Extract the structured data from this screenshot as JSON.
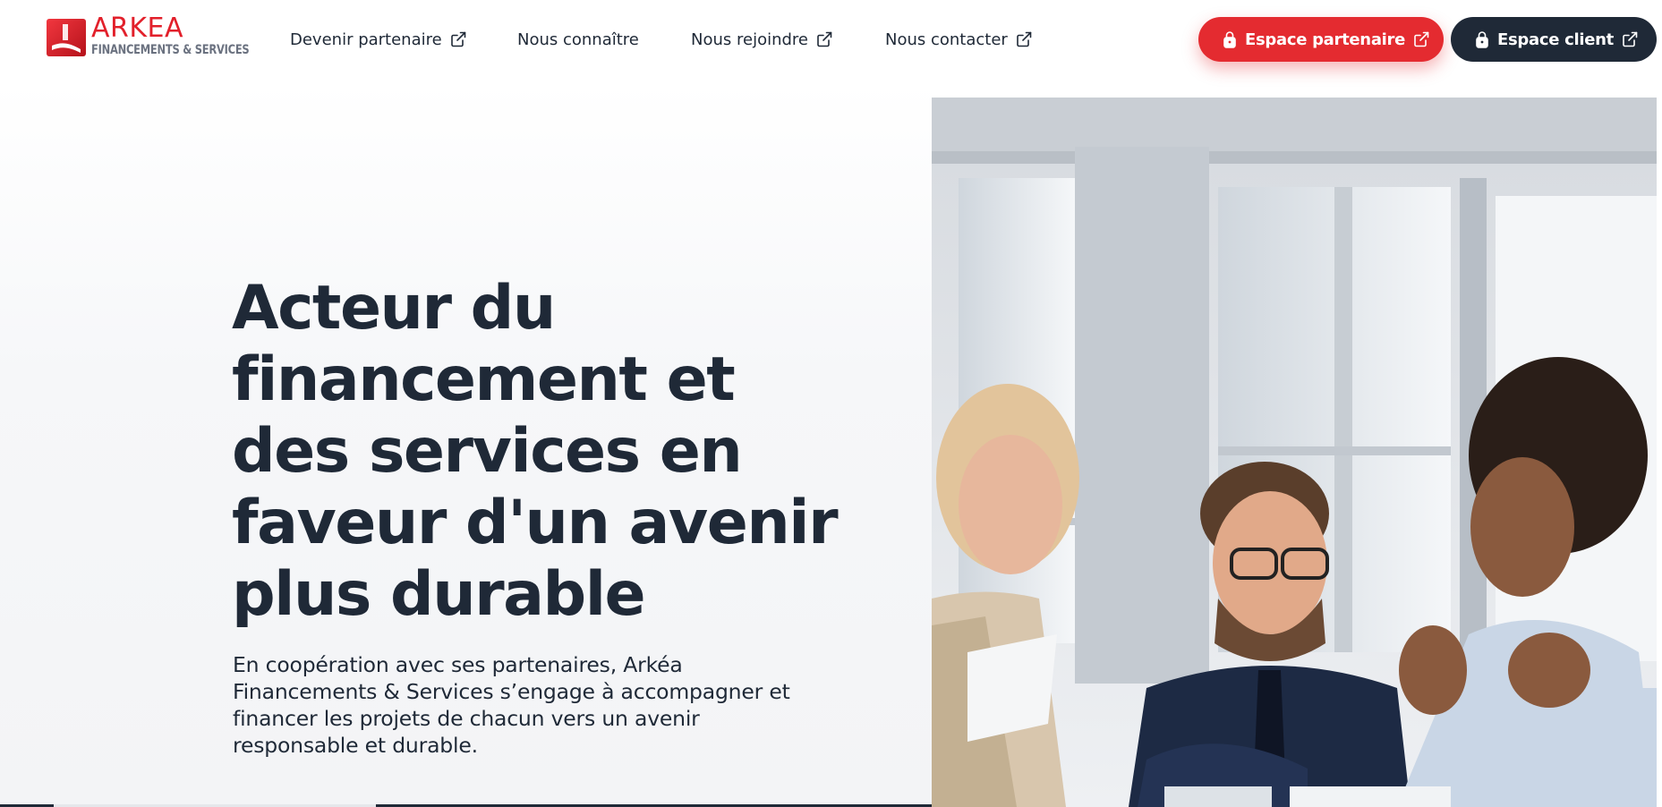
{
  "brand": {
    "name": "ARKEA",
    "subtitle": "FINANCEMENTS & SERVICES",
    "color": "#e2202b"
  },
  "nav": {
    "items": [
      {
        "label": "Devenir partenaire",
        "external": true
      },
      {
        "label": "Nous connaître",
        "external": false
      },
      {
        "label": "Nous rejoindre",
        "external": true
      },
      {
        "label": "Nous contacter",
        "external": true
      }
    ]
  },
  "actions": {
    "partner_label": "Espace partenaire",
    "client_label": "Espace client",
    "partner_color": "#e42b30",
    "client_color": "#1f2937"
  },
  "hero": {
    "title": "Acteur du financement et des services en faveur d'un avenir plus durable",
    "text": "En coopération avec ses partenaires, Arkéa Financements & Services s’engage à accompagner et financer les projets de chacun vers un avenir responsable et durable.",
    "image": "photo-business-meeting"
  }
}
